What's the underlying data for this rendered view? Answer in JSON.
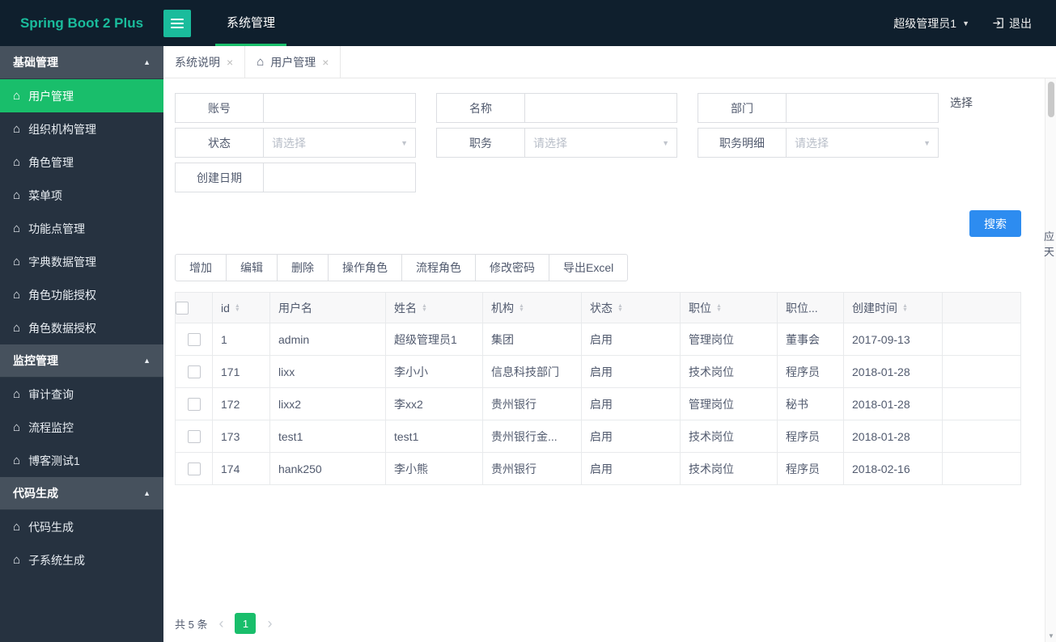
{
  "topbar": {
    "logo": "Spring Boot 2 Plus",
    "nav_item": "系统管理",
    "user": "超级管理员1",
    "logout": "退出"
  },
  "sidebar": {
    "sections": [
      {
        "title": "基础管理",
        "items": [
          "用户管理",
          "组织机构管理",
          "角色管理",
          "菜单项",
          "功能点管理",
          "字典数据管理",
          "角色功能授权",
          "角色数据授权"
        ]
      },
      {
        "title": "监控管理",
        "items": [
          "审计查询",
          "流程监控",
          "博客测试1"
        ]
      },
      {
        "title": "代码生成",
        "items": [
          "代码生成",
          "子系统生成"
        ]
      }
    ]
  },
  "tabs": [
    {
      "label": "系统说明"
    },
    {
      "label": "用户管理"
    }
  ],
  "form": {
    "fields": [
      {
        "label": "账号",
        "type": "text",
        "value": ""
      },
      {
        "label": "名称",
        "type": "text",
        "value": ""
      },
      {
        "label": "部门",
        "type": "text",
        "value": ""
      },
      {
        "label": "状态",
        "type": "select",
        "placeholder": "请选择"
      },
      {
        "label": "职务",
        "type": "select",
        "placeholder": "请选择"
      },
      {
        "label": "职务明细",
        "type": "select",
        "placeholder": "请选择"
      },
      {
        "label": "创建日期",
        "type": "text",
        "value": ""
      }
    ],
    "choose_label": "选择",
    "search_button": "搜索"
  },
  "toolbar": [
    "增加",
    "编辑",
    "删除",
    "操作角色",
    "流程角色",
    "修改密码",
    "导出Excel"
  ],
  "table": {
    "headers": [
      {
        "label": "id",
        "sortable": true
      },
      {
        "label": "用户名",
        "sortable": false
      },
      {
        "label": "姓名",
        "sortable": true
      },
      {
        "label": "机构",
        "sortable": true
      },
      {
        "label": "状态",
        "sortable": true
      },
      {
        "label": "职位",
        "sortable": true
      },
      {
        "label": "职位...",
        "sortable": false
      },
      {
        "label": "创建时间",
        "sortable": true
      }
    ],
    "rows": [
      [
        "1",
        "admin",
        "超级管理员1",
        "集团",
        "启用",
        "管理岗位",
        "董事会",
        "2017-09-13"
      ],
      [
        "171",
        "lixx",
        "李小小",
        "信息科技部门",
        "启用",
        "技术岗位",
        "程序员",
        "2018-01-28"
      ],
      [
        "172",
        "lixx2",
        "李xx2",
        "贵州银行",
        "启用",
        "管理岗位",
        "秘书",
        "2018-01-28"
      ],
      [
        "173",
        "test1",
        "test1",
        "贵州银行金...",
        "启用",
        "技术岗位",
        "程序员",
        "2018-01-28"
      ],
      [
        "174",
        "hank250",
        "李小熊",
        "贵州银行",
        "启用",
        "技术岗位",
        "程序员",
        "2018-02-16"
      ]
    ]
  },
  "pagination": {
    "total": "共 5 条",
    "page": "1"
  },
  "edge_text": [
    "应",
    "天"
  ],
  "colors": {
    "logo_teal": "#1abc9c",
    "accent_green": "#19be6b",
    "search_blue": "#2d8cf0",
    "topbar_bg": "#0f1f2d",
    "sidebar_bg": "#263240",
    "section_header_bg": "#46515d"
  }
}
